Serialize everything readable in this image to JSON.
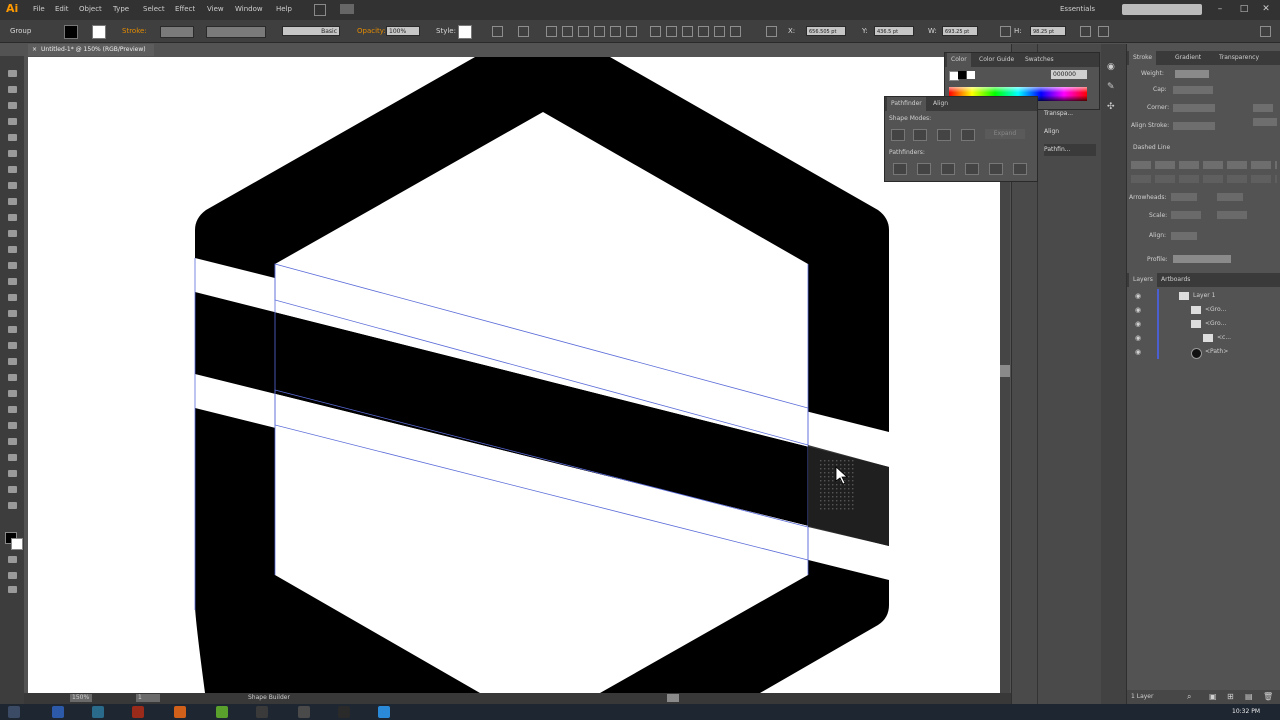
{
  "app": {
    "logo": "Ai",
    "menus": [
      "File",
      "Edit",
      "Object",
      "Type",
      "Select",
      "Effect",
      "View",
      "Window",
      "Help"
    ],
    "workspace": "Essentials",
    "window_buttons": [
      "–",
      "□",
      "✕"
    ]
  },
  "control_bar": {
    "selection_label": "Group",
    "stroke_label": "Stroke:",
    "stroke_profile": "Basic",
    "opacity_label": "Opacity:",
    "opacity_value": "100%",
    "style_label": "Style:",
    "x_value": "656.505 pt",
    "y_value": "436.5 pt",
    "w_value": "693.25 pt",
    "h_value": "98.25 pt"
  },
  "document": {
    "tab_title": "Untitled-1* @ 150% (RGB/Preview)",
    "close": "×",
    "zoom": "150%",
    "page": "1",
    "status": "Shape Builder"
  },
  "color_panel": {
    "tabs": [
      "Color",
      "Color Guide",
      "Swatches"
    ],
    "hex": "000000"
  },
  "pathfinder": {
    "tabs": [
      "Pathfinder",
      "Align"
    ],
    "shape_modes_label": "Shape Modes:",
    "expand_label": "Expand",
    "pathfinders_label": "Pathfinders:"
  },
  "transparency_stack": [
    "Transpa...",
    "Align",
    "Pathfin..."
  ],
  "stroke_panel": {
    "tabs": [
      "Stroke",
      "Gradient",
      "Transparency"
    ],
    "weight_label": "Weight:",
    "cap_label": "Cap:",
    "corner_label": "Corner:",
    "align_label": "Align Stroke:",
    "dashed_label": "Dashed Line",
    "arrowheads_label": "Arrowheads:",
    "scale_label": "Scale:",
    "align2_label": "Align:",
    "profile_label": "Profile:"
  },
  "layers_panel": {
    "tabs": [
      "Layers",
      "Artboards"
    ],
    "rows": [
      {
        "name": "Layer 1",
        "indent": 0
      },
      {
        "name": "<Gro...",
        "indent": 1
      },
      {
        "name": "<Gro...",
        "indent": 1
      },
      {
        "name": "<c...",
        "indent": 2
      },
      {
        "name": "<Path>",
        "indent": 1
      }
    ],
    "footer": "1 Layer"
  },
  "taskbar": {
    "time": "10:32 PM"
  },
  "colors": {
    "artwork": "#000000",
    "selection": "#5a6bd8",
    "accent": "#ff9a00"
  }
}
